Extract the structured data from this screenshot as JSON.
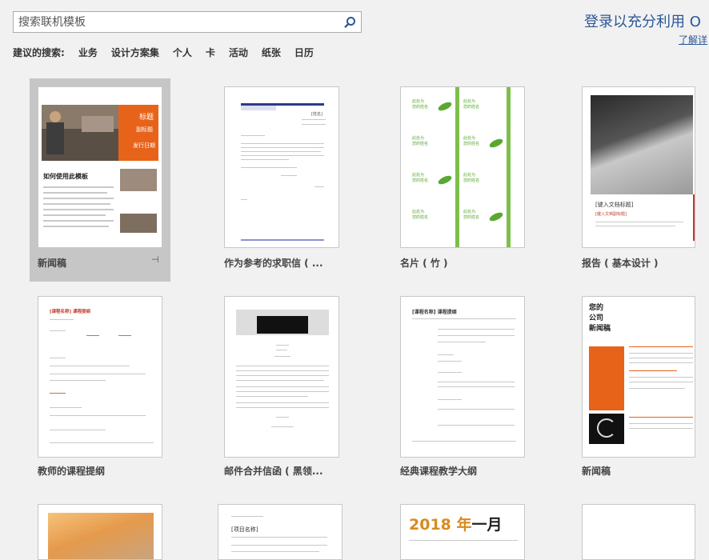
{
  "search": {
    "placeholder": "搜索联机模板"
  },
  "suggested": {
    "label": "建议的搜索:",
    "terms": [
      "业务",
      "设计方案集",
      "个人",
      "卡",
      "活动",
      "纸张",
      "日历"
    ]
  },
  "signin": {
    "text": "登录以充分利用 O",
    "learn_more": "了解详"
  },
  "templates": [
    {
      "name": "新闻稿",
      "selected": true,
      "pinned": true
    },
    {
      "name": "作为参考的求职信 ( ..."
    },
    {
      "name": "名片 ( 竹 )"
    },
    {
      "name": "报告 ( 基本设计 )"
    },
    {
      "name": "教师的课程提纲"
    },
    {
      "name": "邮件合并信函 ( 黑领..."
    },
    {
      "name": "经典课程教学大纲"
    },
    {
      "name": "新闻稿"
    }
  ],
  "thumbs": {
    "newsletter1": {
      "title": "标题",
      "subtitle": "副标题",
      "date": "发行日期",
      "heading": "如何使用此模板"
    },
    "cover_letter": {
      "heading": "[姓名]"
    },
    "report": {
      "title": "[键入文档标题]",
      "subtitle": "[键入文档副标题]"
    },
    "syllabus": {
      "title": "[课程名称] 课程提纲"
    },
    "classic": {
      "title": "[课程名称] 课程提纲"
    },
    "newsletter2": {
      "title_lines": [
        "您的",
        "公司",
        "新闻稿"
      ]
    },
    "calendar": {
      "year": "2018 年",
      "month": "一月"
    },
    "project": {
      "title": "[项目名称]"
    },
    "card": {
      "line1": "此处为",
      "line2": "您的姓名"
    }
  },
  "colors": {
    "accent": "#2b5797",
    "orange": "#e8631a",
    "bamboo_green": "#5aa832",
    "calendar_orange": "#d98b1e"
  }
}
